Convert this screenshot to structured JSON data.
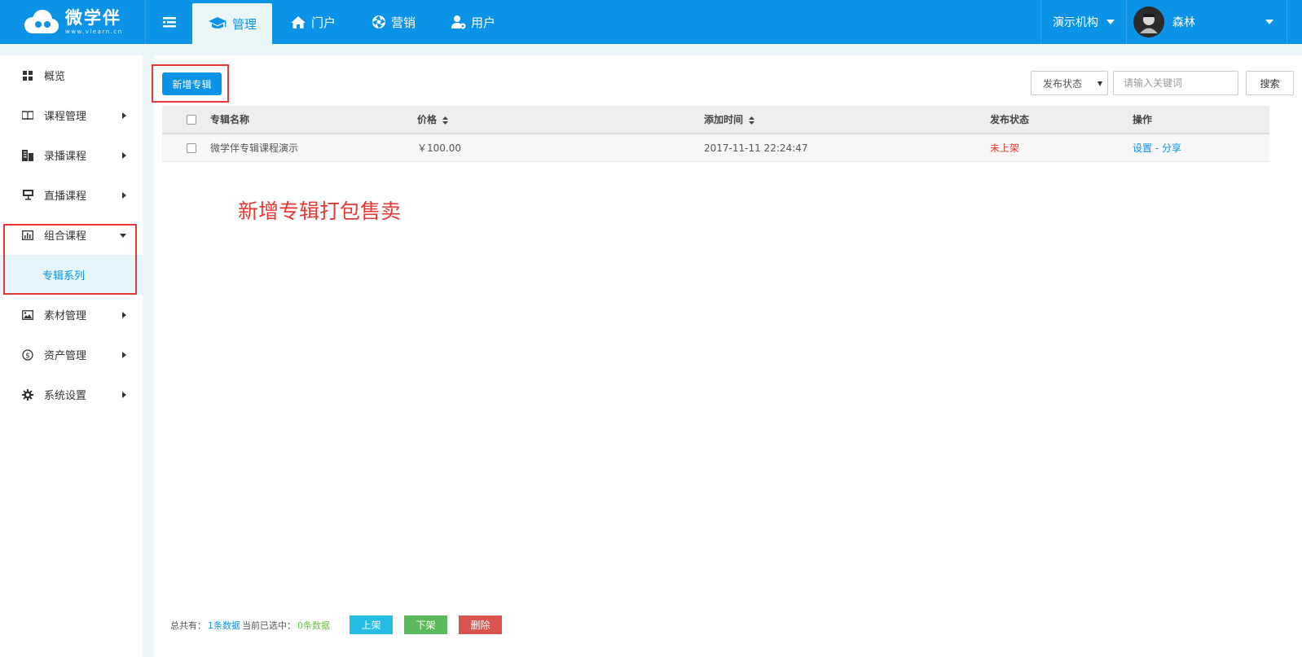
{
  "brand": {
    "name": "微学伴",
    "domain": "www.vlearn.cn"
  },
  "nav": {
    "items": [
      {
        "label": "管理",
        "icon": "graduation-cap-icon",
        "active": true
      },
      {
        "label": "门户",
        "icon": "home-icon",
        "active": false
      },
      {
        "label": "营销",
        "icon": "aperture-icon",
        "active": false
      },
      {
        "label": "用户",
        "icon": "user-gear-icon",
        "active": false
      }
    ],
    "org": "演示机构",
    "user": "森林"
  },
  "sidebar": {
    "items": [
      {
        "label": "概览",
        "icon": "grid-icon"
      },
      {
        "label": "课程管理",
        "icon": "book-icon"
      },
      {
        "label": "录播课程",
        "icon": "building-icon"
      },
      {
        "label": "直播课程",
        "icon": "presentation-icon"
      },
      {
        "label": "组合课程",
        "icon": "bar-chart-icon"
      },
      {
        "label": "素材管理",
        "icon": "image-icon"
      },
      {
        "label": "资产管理",
        "icon": "dollar-circle-icon"
      },
      {
        "label": "系统设置",
        "icon": "gear-icon"
      }
    ],
    "sub_item": "专辑系列"
  },
  "toolbar": {
    "add_label": "新增专辑",
    "status_select": "发布状态",
    "search_placeholder": "请输入关键词",
    "search_label": "搜索"
  },
  "table": {
    "headers": {
      "name": "专辑名称",
      "price": "价格",
      "time": "添加时间",
      "status": "发布状态",
      "op": "操作"
    },
    "rows": [
      {
        "name": "微学伴专辑课程演示",
        "price": "￥100.00",
        "time": "2017-11-11 22:24:47",
        "status": "未上架",
        "op_set": "设置",
        "op_sep": "-",
        "op_share": "分享"
      }
    ]
  },
  "annotation": "新增专辑打包售卖",
  "footer": {
    "total_label": "总共有：",
    "total_value": "1条数据",
    "selected_label": "当前已选中：",
    "selected_value": "0条数据",
    "btn_up": "上架",
    "btn_down": "下架",
    "btn_delete": "删除"
  },
  "colors": {
    "primary": "#0b93e8",
    "danger": "#e53935",
    "success": "#5cb85c",
    "info": "#25bde3"
  }
}
